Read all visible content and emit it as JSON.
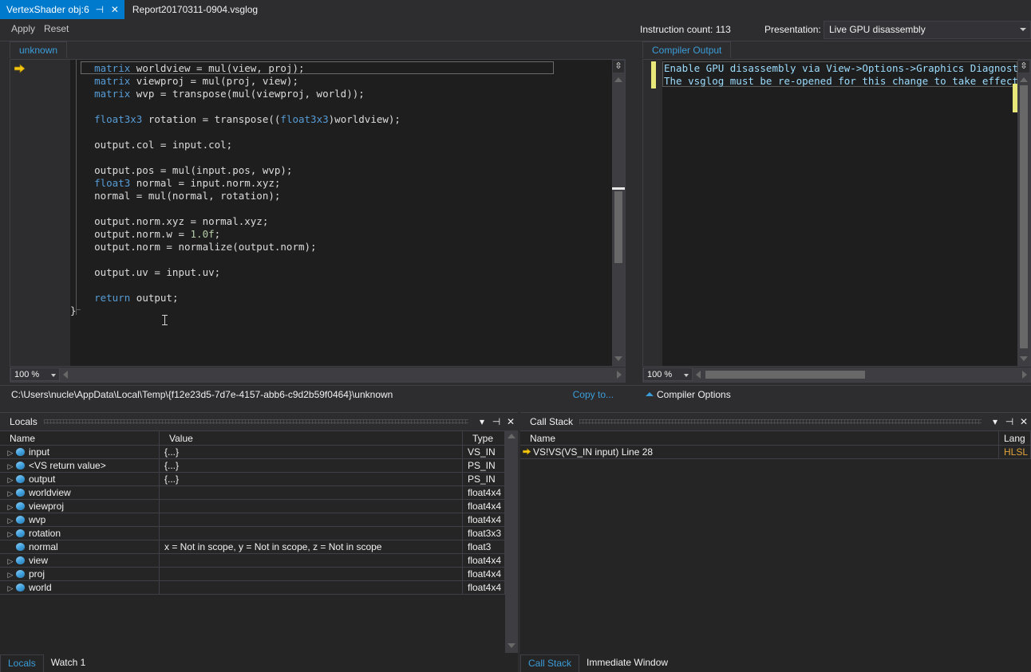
{
  "window": {
    "tabs": [
      {
        "title": "VertexShader obj:6",
        "active": true,
        "pin_icon": "pin-icon",
        "close_icon": "close-icon"
      },
      {
        "title": "Report20170311-0904.vsglog",
        "active": false
      }
    ]
  },
  "toolbar": {
    "apply_label": "Apply",
    "reset_label": "Reset",
    "instruction_count": "Instruction count: 113",
    "presentation_label": "Presentation:",
    "presentation_value": "Live GPU disassembly",
    "presentation_options": [
      "Live GPU disassembly"
    ]
  },
  "editor": {
    "tab_label": "unknown",
    "zoom_level": "100 %",
    "file_path": "C:\\Users\\nucle\\AppData\\Local\\Temp\\{f12e23d5-7d7e-4157-abb6-c9d2b59f0464}\\unknown",
    "copy_to_label": "Copy to...",
    "code_lines": [
      "    matrix worldview = mul(view, proj);",
      "    matrix viewproj = mul(proj, view);",
      "    matrix wvp = transpose(mul(viewproj, world));",
      "",
      "    float3x3 rotation = transpose((float3x3)worldview);",
      "",
      "    output.col = input.col;",
      "",
      "    output.pos = mul(input.pos, wvp);",
      "    float3 normal = input.norm.xyz;",
      "    normal = mul(normal, rotation);",
      "",
      "    output.norm.xyz = normal.xyz;",
      "    output.norm.w = 1.0f;",
      "    output.norm = normalize(output.norm);",
      "",
      "    output.uv = input.uv;",
      "",
      "    return output;",
      "}"
    ]
  },
  "compiler_output": {
    "tab_label": "Compiler Output",
    "zoom_level": "100 %",
    "lines": [
      "Enable GPU disassembly via View->Options->Graphics Diagnostics->",
      "The vsglog must be re-opened for this change to take effect."
    ],
    "options_label": "Compiler Options"
  },
  "locals_panel": {
    "title": "Locals",
    "columns": [
      "Name",
      "Value",
      "Type"
    ],
    "rows": [
      {
        "name": "input",
        "value": "{...}",
        "type": "VS_IN",
        "expandable": true
      },
      {
        "name": "<VS return value>",
        "value": "{...}",
        "type": "PS_IN",
        "expandable": true
      },
      {
        "name": "output",
        "value": "{...}",
        "type": "PS_IN",
        "expandable": true
      },
      {
        "name": "worldview",
        "value": "",
        "type": "float4x4",
        "expandable": true
      },
      {
        "name": "viewproj",
        "value": "",
        "type": "float4x4",
        "expandable": true
      },
      {
        "name": "wvp",
        "value": "",
        "type": "float4x4",
        "expandable": true
      },
      {
        "name": "rotation",
        "value": "",
        "type": "float3x3",
        "expandable": true
      },
      {
        "name": "normal",
        "value": "x = Not in scope, y = Not in scope, z = Not in scope",
        "type": "float3",
        "expandable": false
      },
      {
        "name": "view",
        "value": "",
        "type": "float4x4",
        "expandable": true
      },
      {
        "name": "proj",
        "value": "",
        "type": "float4x4",
        "expandable": true
      },
      {
        "name": "world",
        "value": "",
        "type": "float4x4",
        "expandable": true
      }
    ],
    "bottom_tabs": [
      {
        "label": "Locals",
        "selected": true
      },
      {
        "label": "Watch 1",
        "selected": false
      }
    ]
  },
  "callstack_panel": {
    "title": "Call Stack",
    "columns": [
      "Name",
      "Lang"
    ],
    "rows": [
      {
        "name": "VS!VS(VS_IN input) Line 28",
        "lang": "HLSL",
        "current": true
      }
    ],
    "bottom_tabs": [
      {
        "label": "Call Stack",
        "selected": true
      },
      {
        "label": "Immediate Window",
        "selected": false
      }
    ]
  },
  "icons": {
    "dropdown": "chevron-down-icon",
    "pin": "pin-icon",
    "close": "close-icon",
    "exec_arrow": "execution-pointer-icon",
    "expander": "chevron-right-icon",
    "variable": "variable-icon"
  },
  "colors": {
    "accent": "#007acc",
    "link": "#3b9dd8",
    "editor_bg": "#1e1e1e",
    "chrome_bg": "#2d2d30",
    "panel_bg": "#252526",
    "keyword": "#569cd6",
    "number": "#b5cea8",
    "output_text": "#9cdcfe",
    "marker_yellow": "#e8e87a"
  }
}
